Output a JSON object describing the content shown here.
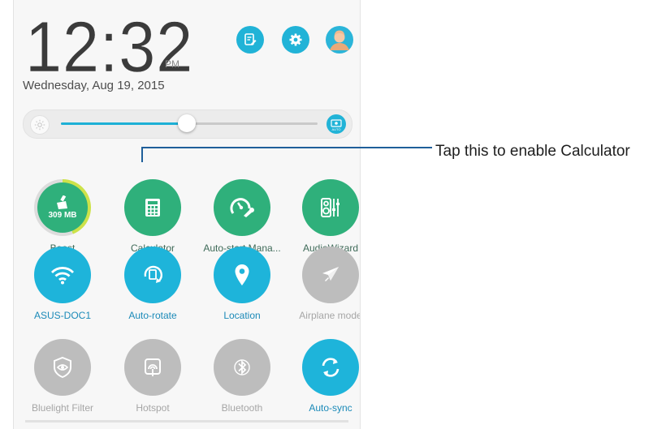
{
  "status": {
    "time": "12:32",
    "ampm": "PM",
    "date": "Wednesday, Aug 19, 2015"
  },
  "top_icons": [
    {
      "name": "notes-icon"
    },
    {
      "name": "settings-icon"
    },
    {
      "name": "profile-icon"
    }
  ],
  "brightness": {
    "level": 0.49,
    "auto_label": "AUTO"
  },
  "tiles": [
    {
      "label": "Boost",
      "value": "309 MB",
      "icon": "broom-icon",
      "state": "green",
      "boost_fraction": 0.44
    },
    {
      "label": "Calculator",
      "icon": "calculator-icon",
      "state": "green"
    },
    {
      "label": "Auto-start Mana...",
      "icon": "speed-wrench-icon",
      "state": "green"
    },
    {
      "label": "AudioWizard",
      "icon": "equalizer-icon",
      "state": "green"
    },
    {
      "label": "ASUS-DOC1",
      "icon": "wifi-icon",
      "state": "blue"
    },
    {
      "label": "Auto-rotate",
      "icon": "rotate-icon",
      "state": "blue"
    },
    {
      "label": "Location",
      "icon": "location-pin-icon",
      "state": "blue"
    },
    {
      "label": "Airplane mode",
      "icon": "airplane-icon",
      "state": "grey"
    },
    {
      "label": "Bluelight Filter",
      "icon": "eye-shield-icon",
      "state": "grey"
    },
    {
      "label": "Hotspot",
      "icon": "hotspot-icon",
      "state": "grey"
    },
    {
      "label": "Bluetooth",
      "icon": "bluetooth-icon",
      "state": "grey"
    },
    {
      "label": "Auto-sync",
      "icon": "sync-icon",
      "state": "blue"
    }
  ],
  "callout": {
    "text": "Tap this to enable Calculator"
  },
  "colors": {
    "accent_blue": "#1eb4da",
    "tile_green": "#2fb07b",
    "tile_grey": "#bdbdbd",
    "callout": "#1f5f9a"
  }
}
